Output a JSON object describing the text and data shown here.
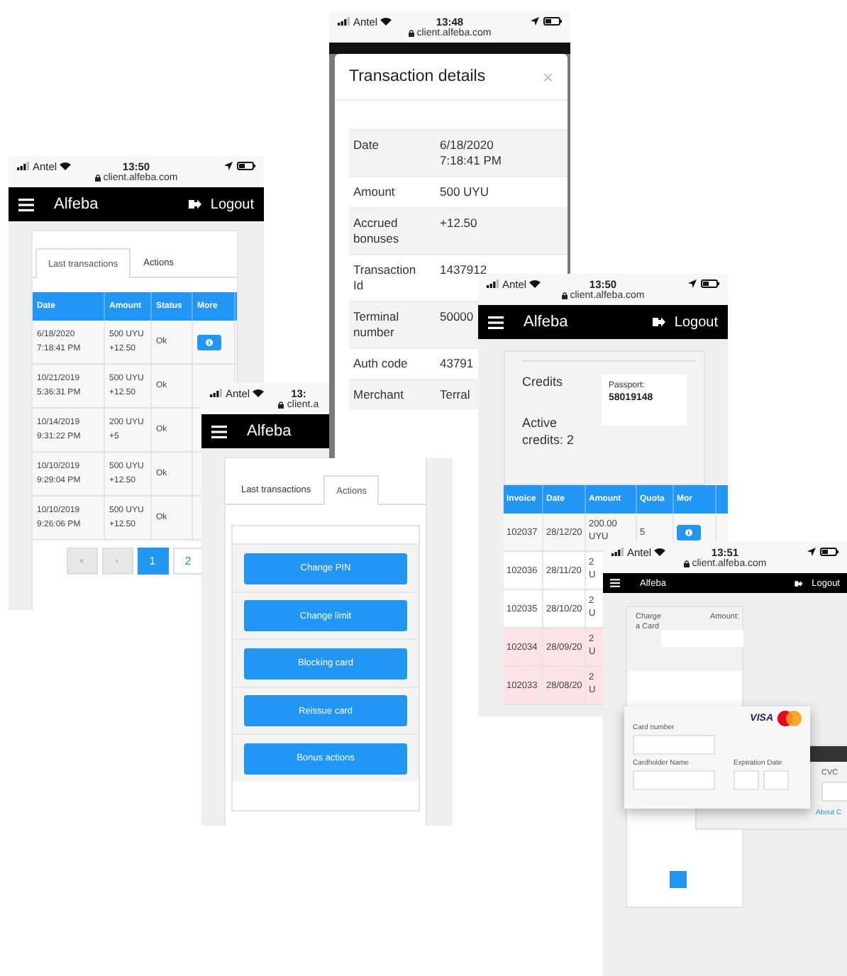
{
  "screens": [
    {
      "kind": "transactions",
      "status": {
        "carrier": "Antel",
        "time": "13:50",
        "url": "client.alfeba.com"
      },
      "nav": {
        "brand": "Alfeba",
        "logout": "Logout"
      },
      "tabs": [
        {
          "label": "Last transactions",
          "selected": true
        },
        {
          "label": "Actions",
          "selected": false
        }
      ],
      "columns": [
        "Date",
        "Amount",
        "Status",
        "More"
      ],
      "rows": [
        {
          "date": [
            "6/18/2020",
            "7:18:41 PM"
          ],
          "amount": [
            "500 UYU",
            "+12.50"
          ],
          "status": "Ok",
          "more_button": true
        },
        {
          "date": [
            "10/21/2019",
            "5:36:31 PM"
          ],
          "amount": [
            "500 UYU",
            "+12.50"
          ],
          "status": "Ok"
        },
        {
          "date": [
            "10/14/2019",
            "9:31:22 PM"
          ],
          "amount": [
            "200 UYU",
            "+5"
          ],
          "status": "Ok"
        },
        {
          "date": [
            "10/10/2019",
            "9:29:04 PM"
          ],
          "amount": [
            "500 UYU",
            "+12.50"
          ],
          "status": "Ok"
        },
        {
          "date": [
            "10/10/2019",
            "9:26:06 PM"
          ],
          "amount": [
            "500 UYU",
            "+12.50"
          ],
          "status": "Ok"
        }
      ],
      "pagination": [
        {
          "label": "«",
          "selected": false
        },
        {
          "label": "‹",
          "selected": false
        },
        {
          "label": "1",
          "selected": true
        },
        {
          "label": "2",
          "selected": false
        }
      ]
    },
    {
      "kind": "details",
      "status": {
        "carrier": "Antel",
        "time": "13:48",
        "url": "client.alfeba.com"
      },
      "modal": {
        "title": "Transaction details",
        "close": "×",
        "rows": [
          {
            "label": "Date",
            "value": "6/18/2020 7:18:41 PM"
          },
          {
            "label": "Amount",
            "value": "500 UYU"
          },
          {
            "label": "Accrued bonuses",
            "value": "+12.50"
          },
          {
            "label": "Transaction Id",
            "value": "1437912"
          },
          {
            "label": "Terminal number",
            "value": "50000"
          },
          {
            "label": "Auth code",
            "value": "43791"
          },
          {
            "label": "Merchant",
            "value": "Terral"
          }
        ]
      }
    },
    {
      "kind": "actions",
      "status": {
        "carrier": "Antel",
        "time": "13:",
        "url": "client.a"
      },
      "nav": {
        "brand": "Alfeba"
      },
      "tabs": [
        {
          "label": "Last transactions",
          "selected": false
        },
        {
          "label": "Actions",
          "selected": true
        }
      ],
      "buttons": [
        "Change PIN",
        "Change limit",
        "Blocking card",
        "Reissue card",
        "Bonus actions"
      ]
    },
    {
      "kind": "credits",
      "status": {
        "carrier": "Antel",
        "time": "13:50",
        "url": "client.alfeba.com"
      },
      "nav": {
        "brand": "Alfeba",
        "logout": "Logout"
      },
      "title": "Credits",
      "active": "Active credits: 2",
      "passport": {
        "label": "Passport:",
        "number": "58019148"
      },
      "columns": [
        "Invoice",
        "Date",
        "Amount",
        "Quota",
        "Mor"
      ],
      "rows": [
        {
          "invoice": "102037",
          "date": "28/12/20",
          "amount": [
            "200.00",
            "UYU"
          ],
          "quota": "5",
          "more_button": true,
          "overdue": false
        },
        {
          "invoice": "102036",
          "date": "28/11/20",
          "amount": [
            "2",
            "U"
          ],
          "overdue": false
        },
        {
          "invoice": "102035",
          "date": "28/10/20",
          "amount": [
            "2",
            "U"
          ],
          "overdue": false
        },
        {
          "invoice": "102034",
          "date": "28/09/20",
          "amount": [
            "2",
            "U"
          ],
          "overdue": true
        },
        {
          "invoice": "102033",
          "date": "28/08/20",
          "amount": [
            "2",
            "U"
          ],
          "overdue": true
        }
      ]
    },
    {
      "kind": "charge",
      "status": {
        "carrier": "Antel",
        "time": "13:51",
        "url": "client.alfeba.com"
      },
      "nav": {
        "brand": "Alfeba",
        "logout": "Logout"
      },
      "form": {
        "title": "Charge a Card",
        "amount_label": "Amount:"
      },
      "card_popup": {
        "brand": "VISA",
        "card_number": "Card number",
        "holder": "Cardholder Name",
        "expiry": "Expiration Date"
      },
      "back_panel": {
        "cvc": "CVC",
        "link": "About C"
      }
    }
  ]
}
